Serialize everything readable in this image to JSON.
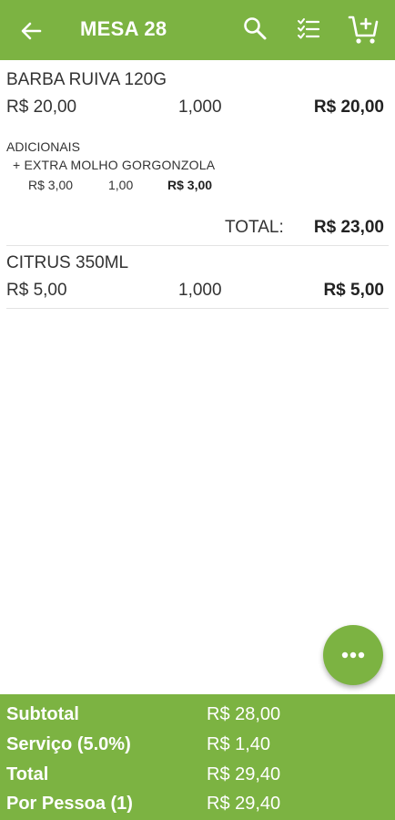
{
  "header": {
    "title": "MESA 28",
    "back_icon": "arrow-back-icon",
    "search_icon": "search-icon",
    "checklist_icon": "checklist-icon",
    "cart_icon": "add-to-cart-icon",
    "color": "#7cb342"
  },
  "items": [
    {
      "name": "BARBA RUIVA 120G",
      "unit_price": "R$ 20,00",
      "quantity": "1,000",
      "total": "R$ 20,00",
      "addons_title": "ADICIONAIS",
      "addons": [
        {
          "name": "+ EXTRA MOLHO GORGONZOLA",
          "unit_price": "R$ 3,00",
          "quantity": "1,00",
          "total": "R$ 3,00"
        }
      ],
      "total_label": "TOTAL:",
      "grand_total": "R$ 23,00"
    },
    {
      "name": "CITRUS 350ML",
      "unit_price": "R$ 5,00",
      "quantity": "1,000",
      "total": "R$ 5,00"
    }
  ],
  "fab": {
    "icon": "more-horizontal-icon"
  },
  "summary": {
    "rows": [
      {
        "label": "Subtotal",
        "value": "R$ 28,00"
      },
      {
        "label": "Serviço (5.0%)",
        "value": "R$ 1,40"
      },
      {
        "label": "Total",
        "value": "R$ 29,40"
      },
      {
        "label": "Por Pessoa (1)",
        "value": "R$ 29,40"
      }
    ]
  }
}
